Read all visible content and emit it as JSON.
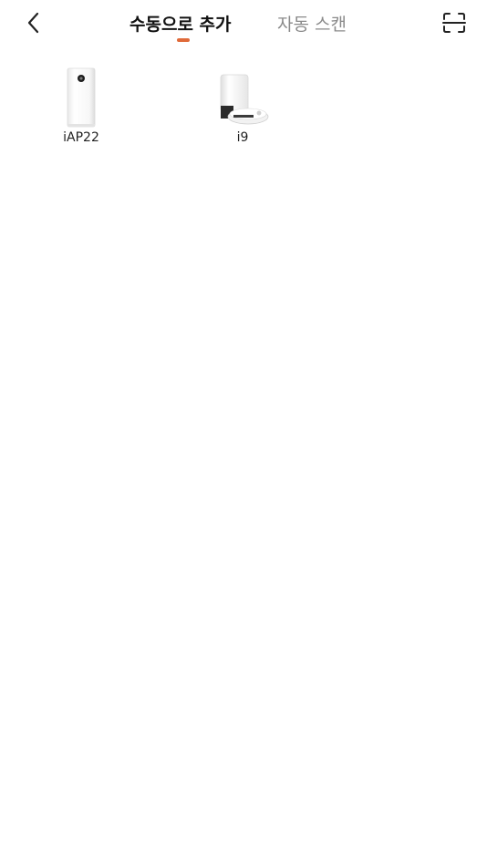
{
  "header": {
    "tabs": [
      {
        "label": "수동으로 추가",
        "active": true
      },
      {
        "label": "자동 스캔",
        "active": false
      }
    ],
    "accent_color": "#e06a3a",
    "back_icon": "chevron-left-icon",
    "scan_icon": "scan-frame-icon"
  },
  "devices": [
    {
      "name": "iAP22",
      "icon": "air-purifier-icon"
    },
    {
      "name": "i9",
      "icon": "robot-vacuum-dock-icon"
    }
  ]
}
